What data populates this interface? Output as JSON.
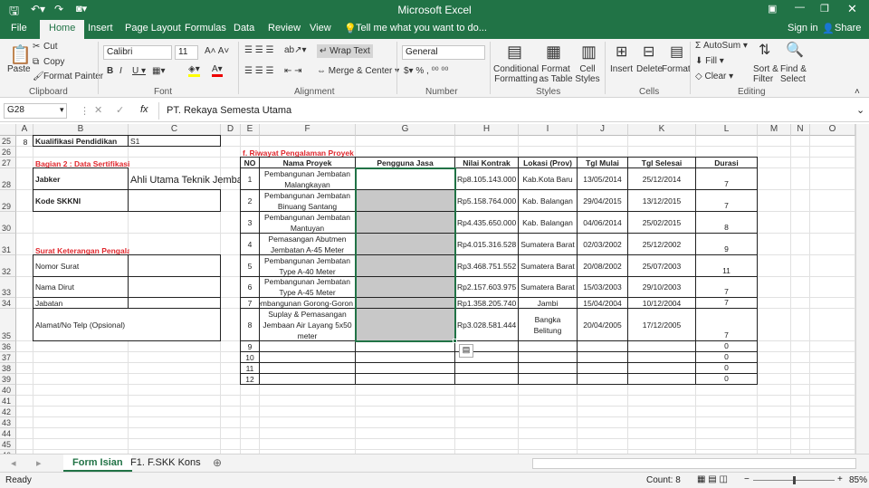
{
  "title": "Microsoft Excel",
  "account": {
    "sign_in": "Sign in",
    "share": "Share"
  },
  "tabs": [
    "File",
    "Home",
    "Insert",
    "Page Layout",
    "Formulas",
    "Data",
    "Review",
    "View"
  ],
  "tell_me": "Tell me what you want to do...",
  "ribbon": {
    "paste": "Paste",
    "cut": "Cut",
    "copy": "Copy",
    "format_painter": "Format Painter",
    "clipboard": "Clipboard",
    "font_name": "Calibri",
    "font_size": "11",
    "font": "Font",
    "wrap_text": "Wrap Text",
    "merge_center": "Merge & Center",
    "alignment": "Alignment",
    "number_format": "General",
    "number": "Number",
    "conditional_formatting": "Conditional Formatting",
    "format_as_table": "Format as Table",
    "cell_styles": "Cell Styles",
    "styles": "Styles",
    "insert": "Insert",
    "delete": "Delete",
    "format": "Format",
    "cells": "Cells",
    "autosum": "AutoSum",
    "fill": "Fill",
    "clear": "Clear",
    "sort_filter": "Sort & Filter",
    "find_select": "Find & Select",
    "editing": "Editing"
  },
  "formula_bar": {
    "name_box": "G28",
    "fx": "fx",
    "value": "PT. Rekaya Semesta Utama"
  },
  "columns": [
    "A",
    "B",
    "C",
    "D",
    "E",
    "F",
    "G",
    "H",
    "I",
    "J",
    "K",
    "L",
    "M",
    "N",
    "O"
  ],
  "rows": [
    "25",
    "26",
    "27",
    "28",
    "29",
    "30",
    "31",
    "32",
    "33",
    "34",
    "35",
    "36",
    "37",
    "38",
    "39",
    "40",
    "41",
    "42",
    "43",
    "44",
    "45",
    "46"
  ],
  "cells": [
    {
      "a": "A25",
      "t": "8",
      "f": "center"
    },
    {
      "a": "B25",
      "t": "Kualifikasi Pendidikan",
      "f": "bd bold"
    },
    {
      "a": "C25",
      "t": "S1",
      "f": "bd"
    },
    {
      "a": "B27",
      "t": "Bagian 2  : Data Sertifikasi",
      "f": "red bottom"
    },
    {
      "a": "B28",
      "t": "Jabker",
      "f": "bd bold"
    },
    {
      "a": "C28",
      "t": "Ahli Utama Teknik Jembatan",
      "f": "big"
    },
    {
      "a": "B29",
      "t": "Kode SKKNI",
      "f": "bd bold"
    },
    {
      "a": "C29",
      "t": "",
      "f": "bd"
    },
    {
      "a": "B31",
      "t": "Surat Keterangan Pengalaman Kerja",
      "f": "red bottom"
    },
    {
      "a": "B32",
      "t": "Nomor Surat",
      "f": "bd"
    },
    {
      "a": "C32",
      "t": "",
      "f": "bd"
    },
    {
      "a": "B33",
      "t": "Nama Dirut",
      "f": "bd"
    },
    {
      "a": "C33",
      "t": "",
      "f": "bd"
    },
    {
      "a": "B34",
      "t": "Jabatan",
      "f": "bd"
    },
    {
      "a": "C34",
      "t": "",
      "f": "bd"
    },
    {
      "a": "B35:C35",
      "t": "Alamat/No Telp (Opsional)",
      "f": "bd"
    },
    {
      "a": "E26:F26",
      "t": "f. Riwayat Pengalaman Proyek",
      "f": "red bottom"
    }
  ],
  "project_table": {
    "headers": [
      "NO",
      "Nama Proyek",
      "Pengguna Jasa",
      "Nilai Kontrak",
      "Lokasi (Prov)",
      "Tgl Mulai",
      "Tgl Selesai",
      "Durasi"
    ],
    "currency": "Rp",
    "rows": [
      {
        "no": "1",
        "nama": "Pembangunan Jembatan Malangkayan",
        "pengguna": "",
        "nilai": "8.105.143.000",
        "lokasi": "Kab.Kota Baru",
        "mulai": "13/05/2014",
        "selesai": "25/12/2014",
        "durasi": "7"
      },
      {
        "no": "2",
        "nama": "Pembangunan Jembatan Binuang Santang",
        "pengguna": "",
        "nilai": "5.158.764.000",
        "lokasi": "Kab. Balangan",
        "mulai": "29/04/2015",
        "selesai": "13/12/2015",
        "durasi": "7"
      },
      {
        "no": "3",
        "nama": "Pembangunan Jembatan Mantuyan",
        "pengguna": "",
        "nilai": "4.435.650.000",
        "lokasi": "Kab. Balangan",
        "mulai": "04/06/2014",
        "selesai": "25/02/2015",
        "durasi": "8"
      },
      {
        "no": "4",
        "nama": "Pemasangan Abutmen Jembatan A-45 Meter",
        "pengguna": "",
        "nilai": "4.015.316.528",
        "lokasi": "Sumatera Barat",
        "mulai": "02/03/2002",
        "selesai": "25/12/2002",
        "durasi": "9"
      },
      {
        "no": "5",
        "nama": "Pembangunan Jembatan Type A-40 Meter",
        "pengguna": "",
        "nilai": "3.468.751.552",
        "lokasi": "Sumatera Barat",
        "mulai": "20/08/2002",
        "selesai": "25/07/2003",
        "durasi": "11"
      },
      {
        "no": "6",
        "nama": "Pembangunan Jembatan Type A-45 Meter",
        "pengguna": "",
        "nilai": "2.157.603.975",
        "lokasi": "Sumatera Barat",
        "mulai": "15/03/2003",
        "selesai": "29/10/2003",
        "durasi": "7"
      },
      {
        "no": "7",
        "nama": "embangunan Gorong-Goron",
        "pengguna": "",
        "nilai": "1.358.205.740",
        "lokasi": "Jambi",
        "mulai": "15/04/2004",
        "selesai": "10/12/2004",
        "durasi": "7"
      },
      {
        "no": "8",
        "nama": "Suplay & Pemasangan Jembaan Air Layang 5x50 meter",
        "pengguna": "",
        "nilai": "3.028.581.444",
        "lokasi": "Bangka Belitung",
        "mulai": "20/04/2005",
        "selesai": "17/12/2005",
        "durasi": "7"
      },
      {
        "no": "9",
        "nama": "",
        "pengguna": "",
        "nilai": "",
        "lokasi": "",
        "mulai": "",
        "selesai": "",
        "durasi": "0"
      },
      {
        "no": "10",
        "nama": "",
        "pengguna": "",
        "nilai": "",
        "lokasi": "",
        "mulai": "",
        "selesai": "",
        "durasi": "0"
      },
      {
        "no": "11",
        "nama": "",
        "pengguna": "",
        "nilai": "",
        "lokasi": "",
        "mulai": "",
        "selesai": "",
        "durasi": "0"
      },
      {
        "no": "12",
        "nama": "",
        "pengguna": "",
        "nilai": "",
        "lokasi": "",
        "mulai": "",
        "selesai": "",
        "durasi": "0"
      }
    ]
  },
  "sheets": [
    {
      "name": "Form Isian",
      "active": true
    },
    {
      "name": "F1. F.SKK Kons",
      "active": false
    }
  ],
  "status": {
    "ready": "Ready",
    "count": "Count: 8",
    "zoom": "85%"
  }
}
